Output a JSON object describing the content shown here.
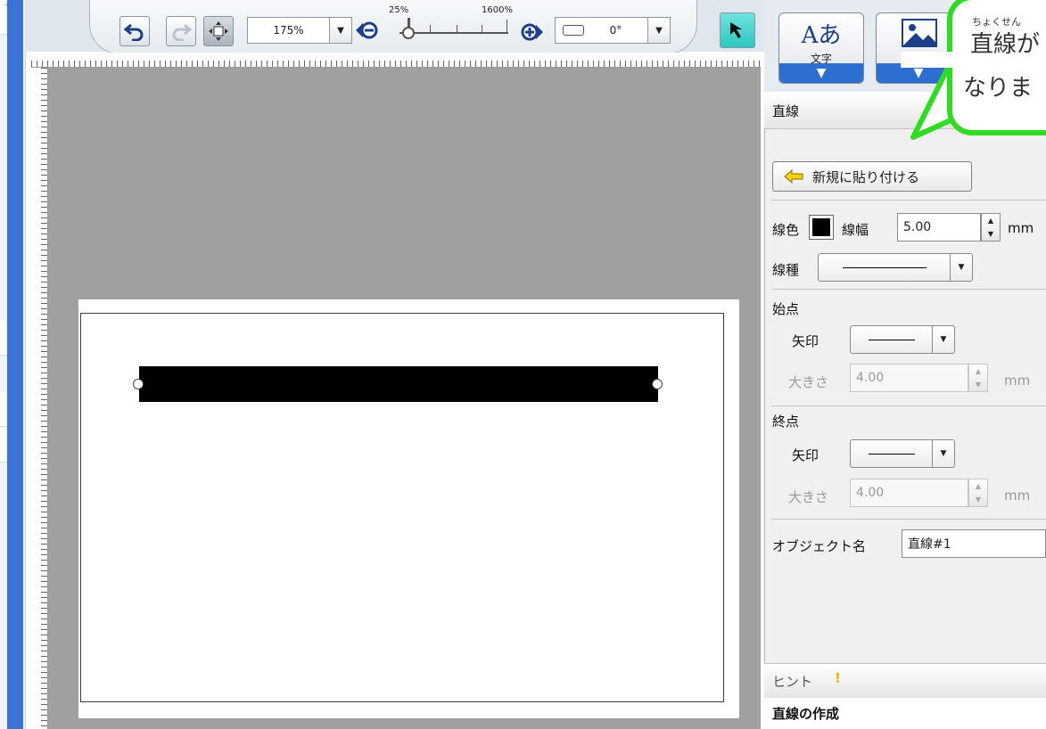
{
  "toolbar": {
    "zoom_value": "175%",
    "zoom_min_label": "25%",
    "zoom_max_label": "1600%",
    "rotation_value": "0°"
  },
  "insert_buttons": {
    "text_label": "文字",
    "text_icon_glyph": "Aあ",
    "image_label": "画像"
  },
  "panel": {
    "title": "直線",
    "paste_new_label": "新規に貼り付ける",
    "line_color_label": "線色",
    "line_width_label": "線幅",
    "line_width_value": "5.00",
    "line_width_unit": "mm",
    "line_type_label": "線種",
    "start_label": "始点",
    "start_arrow_label": "矢印",
    "start_size_label": "大きさ",
    "start_size_value": "4.00",
    "start_size_unit": "mm",
    "end_label": "終点",
    "end_arrow_label": "矢印",
    "end_size_label": "大きさ",
    "end_size_value": "4.00",
    "end_size_unit": "mm",
    "object_name_label": "オブジェクト名",
    "object_name_value": "直線#1"
  },
  "hint": {
    "header": "ヒント",
    "title": "直線の作成"
  },
  "callout": {
    "ruby": "ちょくせん",
    "line1": "直線が",
    "line2": "なりま"
  },
  "colors": {
    "accent_blue": "#2d6fd0",
    "callout_green": "#2fdc22",
    "canvas_gray": "#a0a0a0",
    "select_tool_teal": "#2ec7c0"
  },
  "icons": [
    "undo-icon",
    "redo-icon",
    "fit-page-icon",
    "zoom-out-icon",
    "zoom-in-icon",
    "select-arrow-icon",
    "text-insert-icon",
    "image-insert-icon",
    "paste-arrow-icon",
    "hint-exclamation-icon"
  ]
}
